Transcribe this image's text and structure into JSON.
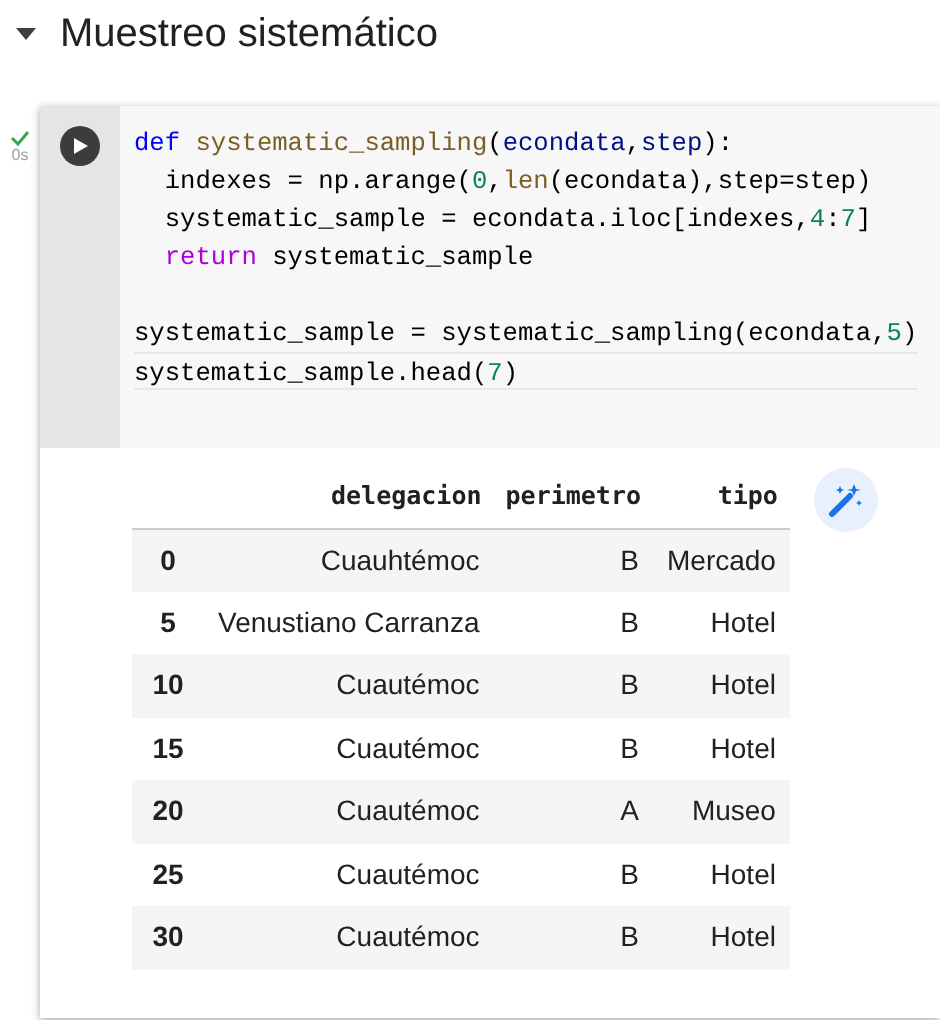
{
  "section": {
    "title": "Muestreo sistemático",
    "expanded": true
  },
  "cell": {
    "status": "0s",
    "succeeded": true,
    "code": [
      [
        {
          "kind": "keyword",
          "text": "def"
        },
        {
          "kind": "func",
          "text": " systematic_sampling"
        },
        {
          "kind": "plain",
          "text": "("
        },
        {
          "kind": "param",
          "text": "econdata"
        },
        {
          "kind": "plain",
          "text": ","
        },
        {
          "kind": "param",
          "text": "step"
        },
        {
          "kind": "plain",
          "text": "):"
        }
      ],
      [
        {
          "kind": "plain",
          "text": "  indexes = np.arange("
        },
        {
          "kind": "number",
          "text": "0"
        },
        {
          "kind": "plain",
          "text": ","
        },
        {
          "kind": "func",
          "text": "len"
        },
        {
          "kind": "plain",
          "text": "(econdata),step=step)"
        }
      ],
      [
        {
          "kind": "plain",
          "text": "  systematic_sample = econdata.iloc[indexes,"
        },
        {
          "kind": "number",
          "text": "4"
        },
        {
          "kind": "plain",
          "text": ":"
        },
        {
          "kind": "number",
          "text": "7"
        },
        {
          "kind": "plain",
          "text": "]"
        }
      ],
      [
        {
          "kind": "control",
          "text": "  return"
        },
        {
          "kind": "plain",
          "text": " systematic_sample"
        }
      ],
      [
        {
          "kind": "gap"
        },
        {
          "kind": "plain",
          "text": "systematic_sample = systematic_sampling(econdata,"
        },
        {
          "kind": "number",
          "text": "5"
        },
        {
          "kind": "plain",
          "text": ")"
        }
      ],
      [
        {
          "kind": "plain",
          "text": "systematic_sample.head("
        },
        {
          "kind": "number",
          "text": "7"
        },
        {
          "kind": "plain",
          "text": ")"
        }
      ]
    ],
    "output": {
      "columns": [
        "delegacion",
        "perimetro",
        "tipo"
      ],
      "rows": [
        {
          "index": "0",
          "cells": [
            "Cuauhtémoc",
            "B",
            "Mercado"
          ]
        },
        {
          "index": "5",
          "cells": [
            "Venustiano Carranza",
            "B",
            "Hotel"
          ]
        },
        {
          "index": "10",
          "cells": [
            "Cuautémoc",
            "B",
            "Hotel"
          ]
        },
        {
          "index": "15",
          "cells": [
            "Cuautémoc",
            "B",
            "Hotel"
          ]
        },
        {
          "index": "20",
          "cells": [
            "Cuautémoc",
            "A",
            "Museo"
          ]
        },
        {
          "index": "25",
          "cells": [
            "Cuautémoc",
            "B",
            "Hotel"
          ]
        },
        {
          "index": "30",
          "cells": [
            "Cuautémoc",
            "B",
            "Hotel"
          ]
        }
      ]
    }
  }
}
